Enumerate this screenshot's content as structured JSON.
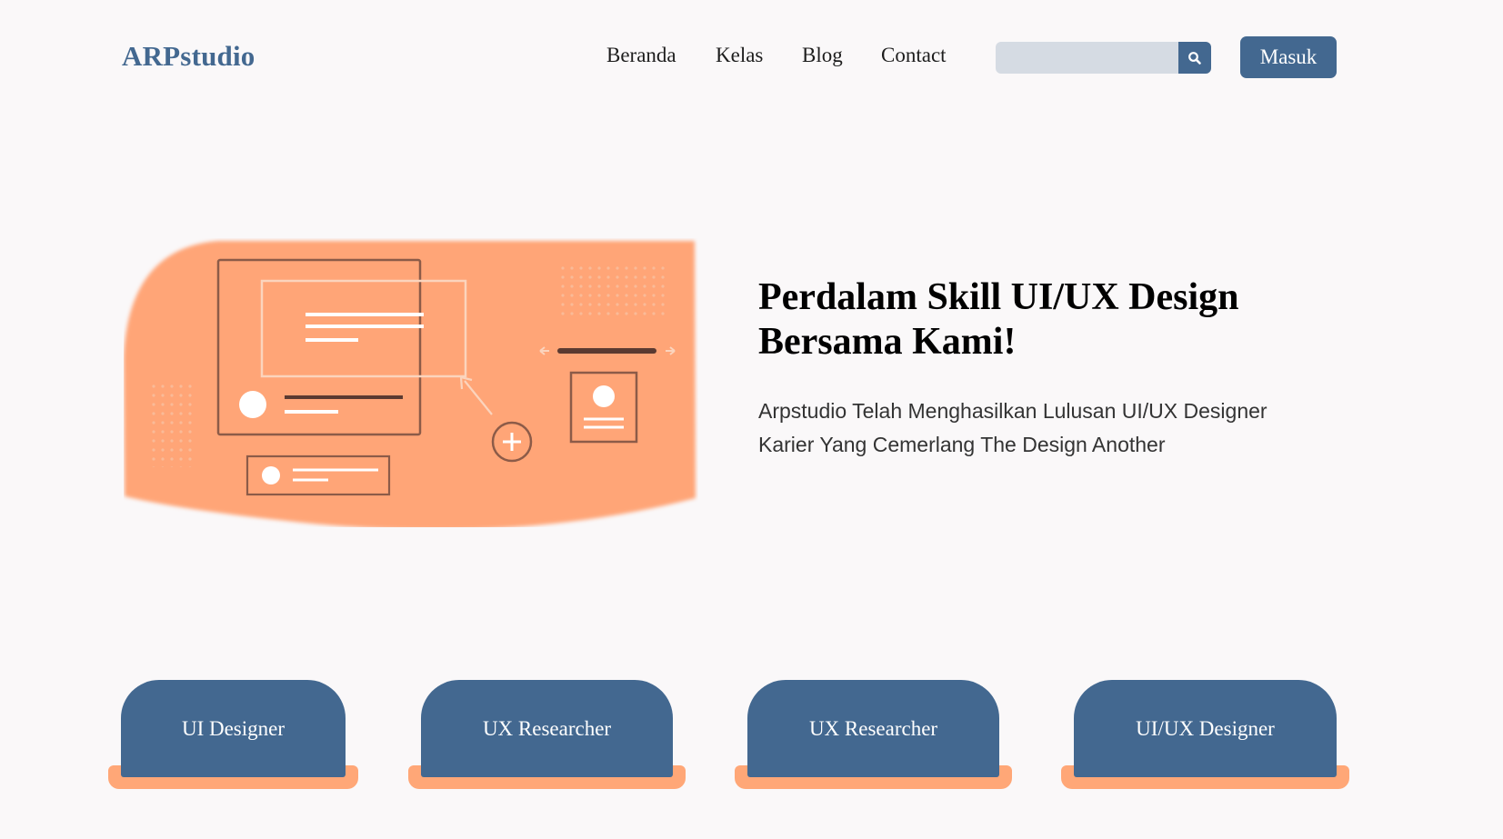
{
  "header": {
    "logo": "ARPstudio",
    "nav": [
      "Beranda",
      "Kelas",
      "Blog",
      "Contact"
    ],
    "search_placeholder": "",
    "login_label": "Masuk"
  },
  "hero": {
    "title_line1": "Perdalam Skill UI/UX Design",
    "title_line2": "Bersama Kami!",
    "description_line1": "Arpstudio Telah Menghasilkan Lulusan UI/UX Designer",
    "description_line2": "Karier Yang Cemerlang The Design Another"
  },
  "roles": [
    "UI Designer",
    "UX Researcher",
    "UX Researcher",
    "UI/UX Designer"
  ],
  "colors": {
    "brand": "#436890",
    "accent": "#ffa777",
    "background": "#faf8f9",
    "search_bg": "#d5dbe3"
  }
}
